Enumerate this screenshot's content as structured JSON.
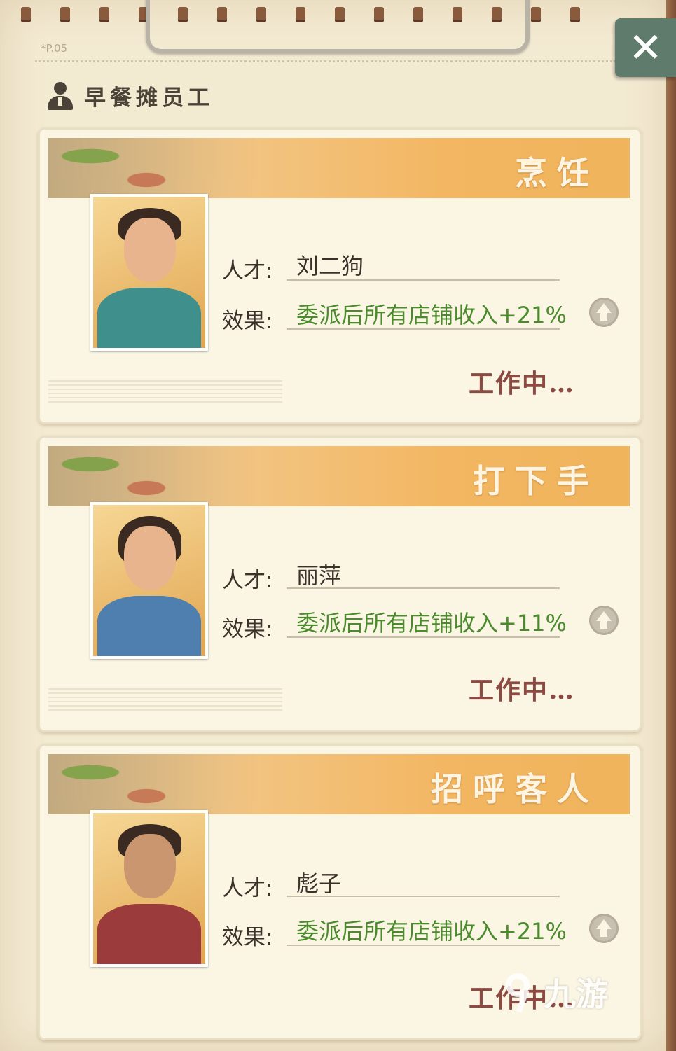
{
  "page": {
    "page_number": "*P.05",
    "section_title": "早餐摊员工",
    "close_label": "✕"
  },
  "labels": {
    "talent": "人才:",
    "effect": "效果:"
  },
  "employees": [
    {
      "role": "烹饪",
      "name": "刘二狗",
      "effect": "委派后所有店铺收入+21%",
      "status": "工作中…"
    },
    {
      "role": "打下手",
      "name": "丽萍",
      "effect": "委派后所有店铺收入+11%",
      "status": "工作中…"
    },
    {
      "role": "招呼客人",
      "name": "彪子",
      "effect": "委派后所有店铺收入+21%",
      "status": "工作中…"
    }
  ],
  "watermark": {
    "text": "九游"
  },
  "colors": {
    "effect_text": "#4b8b2d",
    "status_text": "#8c4a43",
    "close_button": "#5f7b6c",
    "header_orange": "#f3b661"
  }
}
